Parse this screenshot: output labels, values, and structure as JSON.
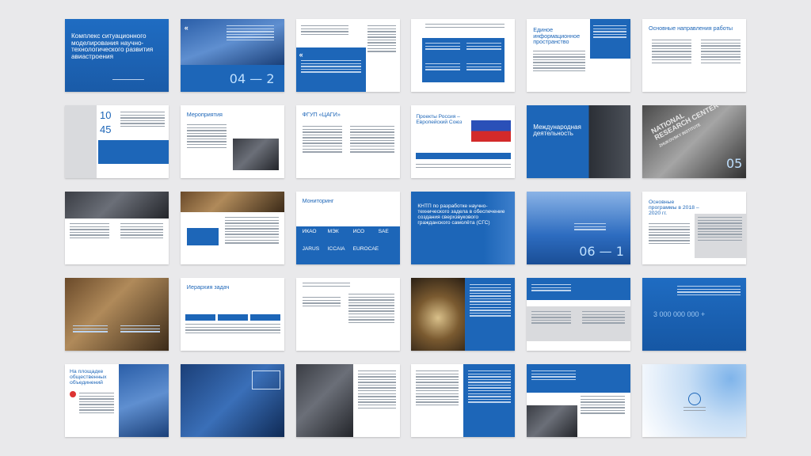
{
  "slides": {
    "s1_title": "Комплекс ситуационного моделирования научно-технологического развития авиастроения",
    "s2_number": "04 — 2",
    "s5_title": "Единое информационное пространство",
    "s6_title": "Основные направления работы",
    "s7_num1": "10",
    "s7_num2": "45",
    "s8_title": "Мероприятия",
    "s9_title": "ФГУП «ЦАГИ»",
    "s10_title": "Проекты Россия – Европейский Союз",
    "s11_title": "Международная деятельность",
    "s12_number": "05",
    "s12_sign1": "NATIONAL",
    "s12_sign2": "RESEARCH CENTER",
    "s12_sign3": "ZHUKOVSKY INSTITUTE",
    "s15_title": "Мониторинг",
    "s15_orgs": [
      "ИКАО",
      "МЭК",
      "ИСО",
      "SAE",
      "JARUS",
      "ICCAIA",
      "EUROCAE"
    ],
    "s16_title": "КНТП по разработке научно-технического задела в обеспечение создания сверхзвукового гражданского самолёта (СГС)",
    "s17_number": "06 — 1",
    "s18_title": "Основные программы в 2018 – 2020 гг.",
    "s20_title": "Иерархия задач",
    "s24_amount": "3 000 000 000 +",
    "s25_title": "На площадке общественных объединений"
  },
  "colors": {
    "background": "#e9e9eb",
    "brand_blue": "#1d66b8",
    "dark_blue": "#134f97",
    "slide_white": "#ffffff"
  }
}
